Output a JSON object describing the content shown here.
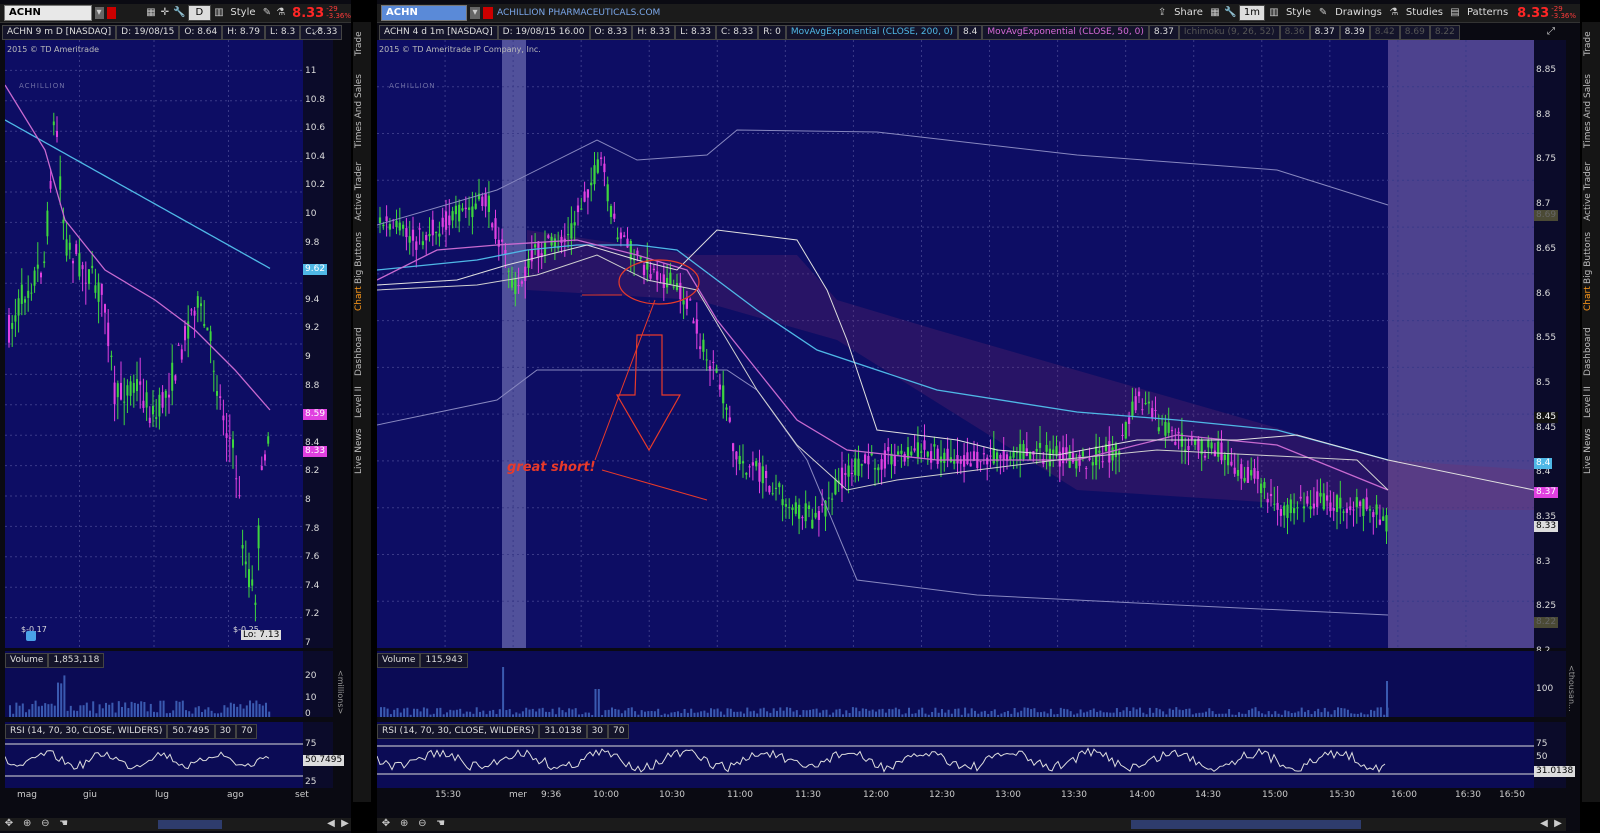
{
  "left": {
    "symbol": "ACHN",
    "period": "D",
    "style_label": "Style",
    "price": "8.33",
    "chg1": "-29",
    "chg2": "-3.36%",
    "info": {
      "name": "ACHN 9 m D [NASDAQ]",
      "date": "D: 19/08/15",
      "open": "O: 8.64",
      "high": "H: 8.79",
      "low": "L: 8.3",
      "close": "C: 8.33"
    },
    "copyright": "2015 © TD Ameritrade",
    "logo": "ACHILLION",
    "price_axis": [
      "11",
      "10.8",
      "10.6",
      "10.4",
      "10.2",
      "10",
      "9.8",
      "9.6",
      "9.4",
      "9.2",
      "9",
      "8.8",
      "8.6",
      "8.4",
      "8.2",
      "8",
      "7.8",
      "7.6",
      "7.4",
      "7.2",
      "7"
    ],
    "tags": {
      "ma200": "9.62",
      "ma50": "8.59",
      "last": "8.33"
    },
    "earnings_1": "$-0.17",
    "earnings_2": "$-0.25",
    "low_label": "Lo: 7.13",
    "volume_label": "Volume",
    "volume_value": "1,853,118",
    "volume_axis": [
      "20",
      "10",
      "0"
    ],
    "volume_unit": "<millions>",
    "rsi_label": "RSI (14, 70, 30, CLOSE, WILDERS)",
    "rsi_value": "50.7495",
    "rsi_ob": "30",
    "rsi_os": "70",
    "rsi_axis": [
      "75",
      "50",
      "25"
    ],
    "time_axis": [
      "mag",
      "giu",
      "lug",
      "ago",
      "set"
    ]
  },
  "right": {
    "symbol": "ACHN",
    "company": "ACHILLION PHARMACEUTICALS.COM",
    "share_label": "Share",
    "period": "1m",
    "style_label": "Style",
    "drawings_label": "Drawings",
    "studies_label": "Studies",
    "patterns_label": "Patterns",
    "price": "8.33",
    "chg1": "-29",
    "chg2": "-3.36%",
    "info": {
      "name": "ACHN 4 d 1m [NASDAQ]",
      "date": "D: 19/08/15 16.00",
      "open": "O: 8.33",
      "high": "H: 8.33",
      "low": "L: 8.33",
      "close": "C: 8.33",
      "r": "R: 0",
      "ma1": "MovAvgExponential (CLOSE, 200, 0)",
      "ma1v": "8.4",
      "ma2": "MovAvgExponential (CLOSE, 50, 0)",
      "ma2v": "8.37",
      "extra": "Ichimoku (9, 26, 52)",
      "extra1": "8.36",
      "extra2": "8.37",
      "extra3": "8.39",
      "extra4": "8.42",
      "extra5": "8.69",
      "extra6": "8.22"
    },
    "copyright": "2015 © TD Ameritrade IP Company, Inc.",
    "logo": "ACHILLION",
    "annotation": "great short!",
    "price_axis": [
      "8.85",
      "8.8",
      "8.75",
      "8.7",
      "8.65",
      "8.6",
      "8.55",
      "8.5",
      "8.45",
      "8.4",
      "8.35",
      "8.3",
      "8.25",
      "8.2"
    ],
    "tags": {
      "upper": "8.69",
      "t845": "8.45",
      "ma200": "8.4",
      "ma50": "8.37",
      "last": "8.33",
      "lower": "8.22"
    },
    "volume_label": "Volume",
    "volume_value": "115,943",
    "volume_axis": [
      "100"
    ],
    "volume_unit": "<thousan...",
    "rsi_label": "RSI (14, 70, 30, CLOSE, WILDERS)",
    "rsi_value": "31.0138",
    "rsi_ob": "30",
    "rsi_os": "70",
    "rsi_axis": [
      "75",
      "50",
      "25"
    ],
    "time_axis": [
      "15:30",
      "mer",
      "9:36",
      "10:00",
      "10:30",
      "11:00",
      "11:30",
      "12:00",
      "12:30",
      "13:00",
      "13:30",
      "14:00",
      "14:30",
      "15:00",
      "15:30",
      "16:00",
      "16:30",
      "16:50"
    ]
  },
  "sidebar_tabs": [
    "Trade",
    "Times And Sales",
    "Active Trader",
    "Big Buttons",
    "Chart",
    "Dashboard",
    "Level II",
    "Live News"
  ],
  "active_tab": "Chart",
  "colors": {
    "plot_bg": "#0d0d64",
    "ma200": "#4fb8e6",
    "ma50": "#c86ad0",
    "up_candle": "#3ed63e",
    "down_candle": "#e040e0",
    "annotation": "#e83a2a",
    "after_hours": "#6a5aa0"
  }
}
